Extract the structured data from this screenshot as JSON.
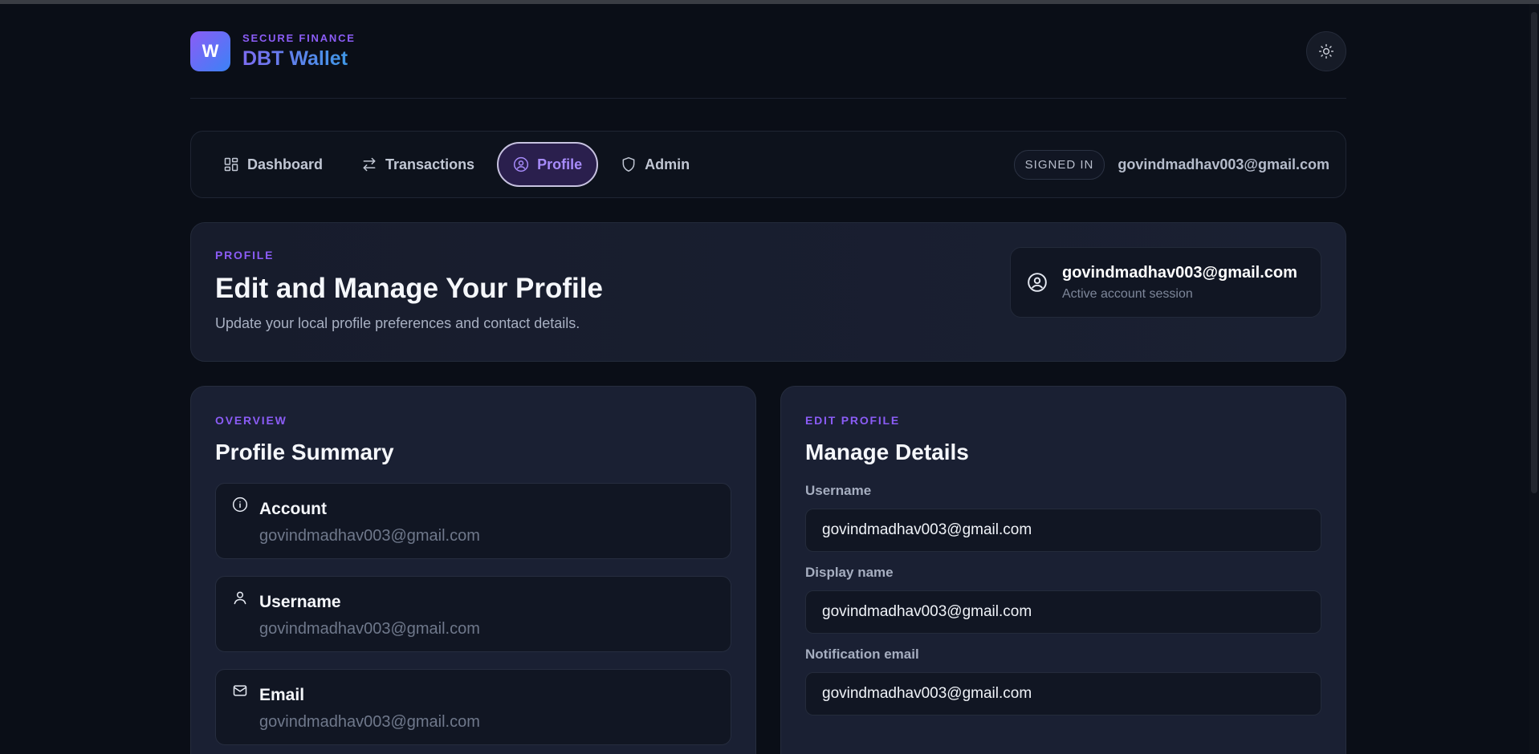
{
  "brand": {
    "eyebrow": "SECURE FINANCE",
    "title": "DBT Wallet",
    "logo_letter": "W"
  },
  "header": {
    "theme_icon": "sun-icon"
  },
  "nav": {
    "items": [
      {
        "label": "Dashboard",
        "icon": "grid-icon",
        "active": false
      },
      {
        "label": "Transactions",
        "icon": "swap-icon",
        "active": false
      },
      {
        "label": "Profile",
        "icon": "user-circle-icon",
        "active": true
      },
      {
        "label": "Admin",
        "icon": "shield-icon",
        "active": false
      }
    ],
    "signed_in_badge": "SIGNED IN",
    "user_email": "govindmadhav003@gmail.com"
  },
  "hero": {
    "eyebrow": "PROFILE",
    "title": "Edit and Manage Your Profile",
    "subtitle": "Update your local profile preferences and contact details.",
    "session_email": "govindmadhav003@gmail.com",
    "session_status": "Active account session"
  },
  "overview": {
    "eyebrow": "OVERVIEW",
    "title": "Profile Summary",
    "items": [
      {
        "label": "Account",
        "value": "govindmadhav003@gmail.com",
        "icon": "info-icon"
      },
      {
        "label": "Username",
        "value": "govindmadhav003@gmail.com",
        "icon": "user-icon"
      },
      {
        "label": "Email",
        "value": "govindmadhav003@gmail.com",
        "icon": "mail-icon"
      }
    ]
  },
  "edit": {
    "eyebrow": "EDIT PROFILE",
    "title": "Manage Details",
    "fields": [
      {
        "label": "Username",
        "value": "govindmadhav003@gmail.com"
      },
      {
        "label": "Display name",
        "value": "govindmadhav003@gmail.com"
      },
      {
        "label": "Notification email",
        "value": "govindmadhav003@gmail.com"
      }
    ]
  },
  "colors": {
    "accent": "#8b5cf6",
    "background": "#0a0e17",
    "panel": "#1a2033"
  }
}
